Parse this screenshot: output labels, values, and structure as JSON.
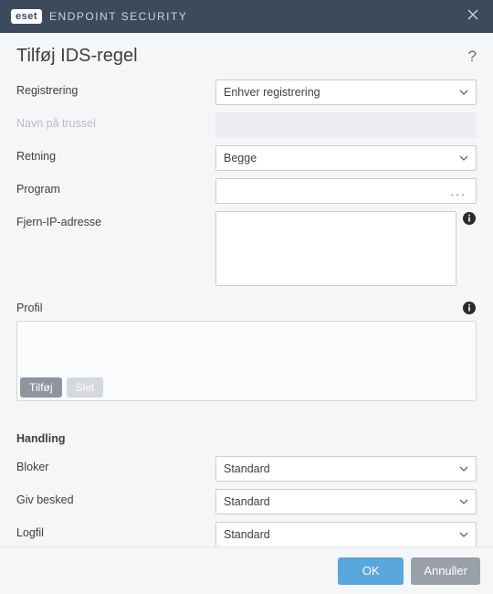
{
  "titlebar": {
    "brand_logo": "eset",
    "brand_text": "ENDPOINT SECURITY"
  },
  "heading": "Tilføj IDS-regel",
  "fields": {
    "detection": {
      "label": "Registrering",
      "value": "Enhver registrering"
    },
    "threat_name": {
      "label": "Navn på trussel"
    },
    "direction": {
      "label": "Retning",
      "value": "Begge"
    },
    "program": {
      "label": "Program",
      "browse": "..."
    },
    "remote_ip": {
      "label": "Fjern-IP-adresse"
    }
  },
  "profile": {
    "label": "Profil",
    "add_label": "Tilføj",
    "delete_label": "Slet"
  },
  "action": {
    "heading": "Handling",
    "block": {
      "label": "Bloker",
      "value": "Standard"
    },
    "notify": {
      "label": "Giv besked",
      "value": "Standard"
    },
    "log": {
      "label": "Logfil",
      "value": "Standard"
    }
  },
  "footer": {
    "ok": "OK",
    "cancel": "Annuller"
  }
}
